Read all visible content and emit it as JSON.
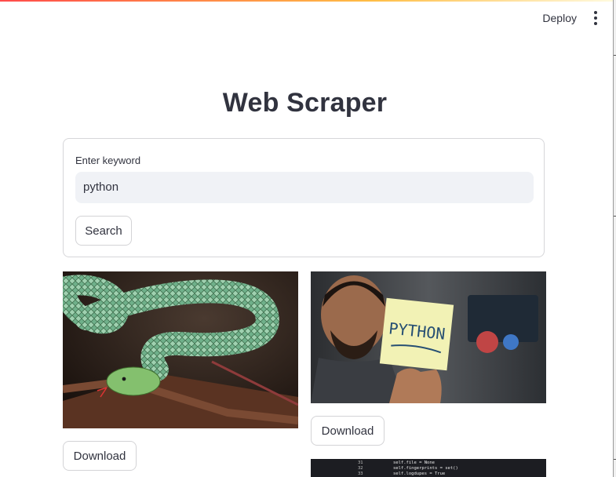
{
  "header": {
    "deploy_label": "Deploy",
    "menu_icon": "kebab-menu-icon"
  },
  "main": {
    "title": "Web Scraper",
    "form": {
      "keyword_label": "Enter keyword",
      "keyword_value": "python",
      "search_label": "Search"
    },
    "results": [
      {
        "image": "green pit viper snake coiled on a branch",
        "download_label": "Download"
      },
      {
        "image": "man holding a sticky note that reads PYTHON",
        "note_text": "PYTHON",
        "download_label": "Download"
      },
      {
        "image": "python source code in a dark editor",
        "code_lines": [
          {
            "num": "31",
            "text": "self.file = None"
          },
          {
            "num": "32",
            "text": "self.fingerprints = set()"
          },
          {
            "num": "33",
            "text": "self.logdupes = True"
          }
        ]
      }
    ]
  }
}
